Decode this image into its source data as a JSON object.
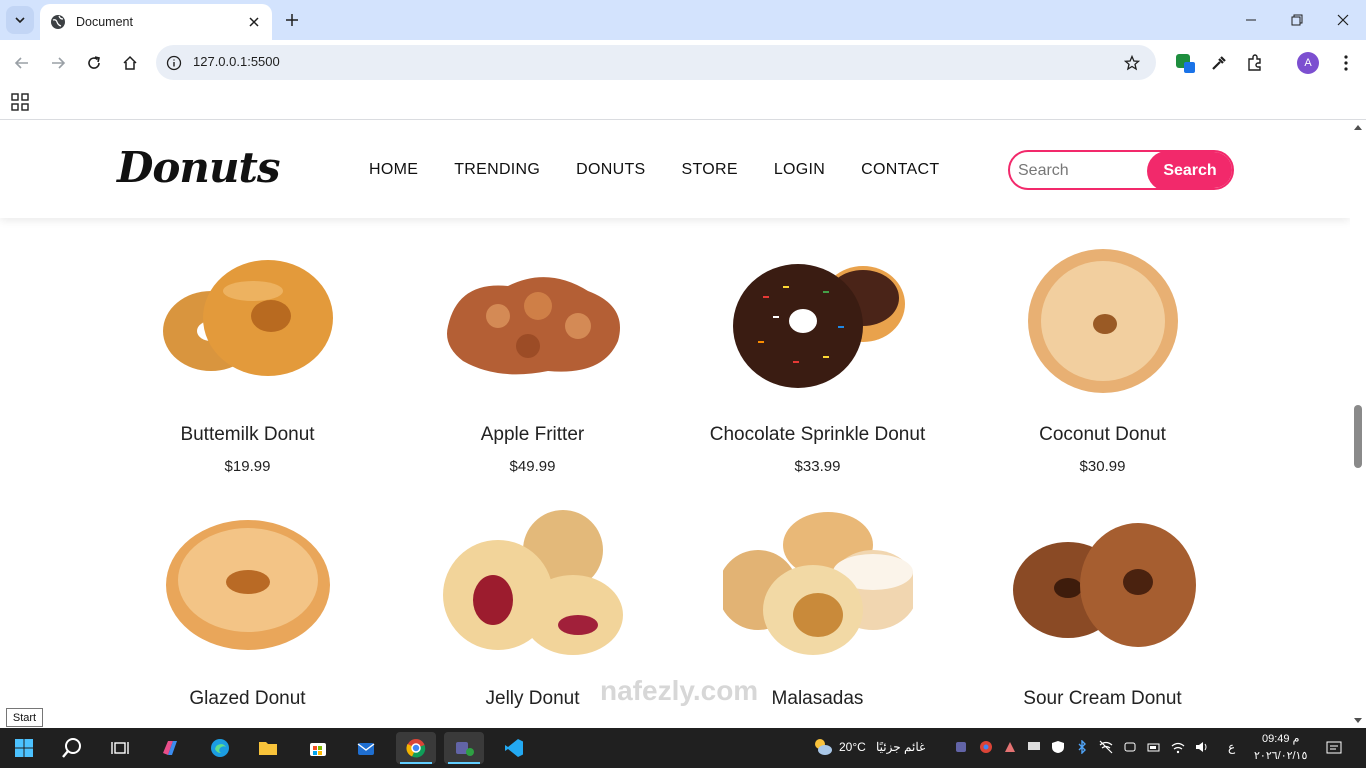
{
  "browser": {
    "tab_title": "Document",
    "url": "127.0.0.1:5500",
    "profile_initial": "A"
  },
  "site": {
    "logo": "Donuts",
    "nav": [
      "HOME",
      "TRENDING",
      "DONUTS",
      "STORE",
      "LOGIN",
      "CONTACT"
    ],
    "search_placeholder": "Search",
    "search_button": "Search",
    "accent_color": "#f2296b"
  },
  "products": [
    {
      "name": "Buttemilk Donut",
      "price": "$19.99",
      "icon": "glazed-donut-pair"
    },
    {
      "name": "Apple Fritter",
      "price": "$49.99",
      "icon": "fritter"
    },
    {
      "name": "Chocolate Sprinkle Donut",
      "price": "$33.99",
      "icon": "sprinkle-donut"
    },
    {
      "name": "Coconut Donut",
      "price": "$30.99",
      "icon": "coconut-donut"
    },
    {
      "name": "Glazed Donut",
      "price": "",
      "icon": "glazed-donut"
    },
    {
      "name": "Jelly Donut",
      "price": "",
      "icon": "jelly-donut"
    },
    {
      "name": "Malasadas",
      "price": "",
      "icon": "malasadas"
    },
    {
      "name": "Sour Cream Donut",
      "price": "",
      "icon": "sour-cream-donut"
    }
  ],
  "overlay": {
    "watermark": "nafezly.com",
    "start_tooltip": "Start"
  },
  "taskbar": {
    "weather_temp": "20°C",
    "weather_text": "غائم جزئيًا",
    "lang": "ع",
    "time": "09:49 م",
    "date": "٢٠٢٦/٠٢/١٥"
  }
}
